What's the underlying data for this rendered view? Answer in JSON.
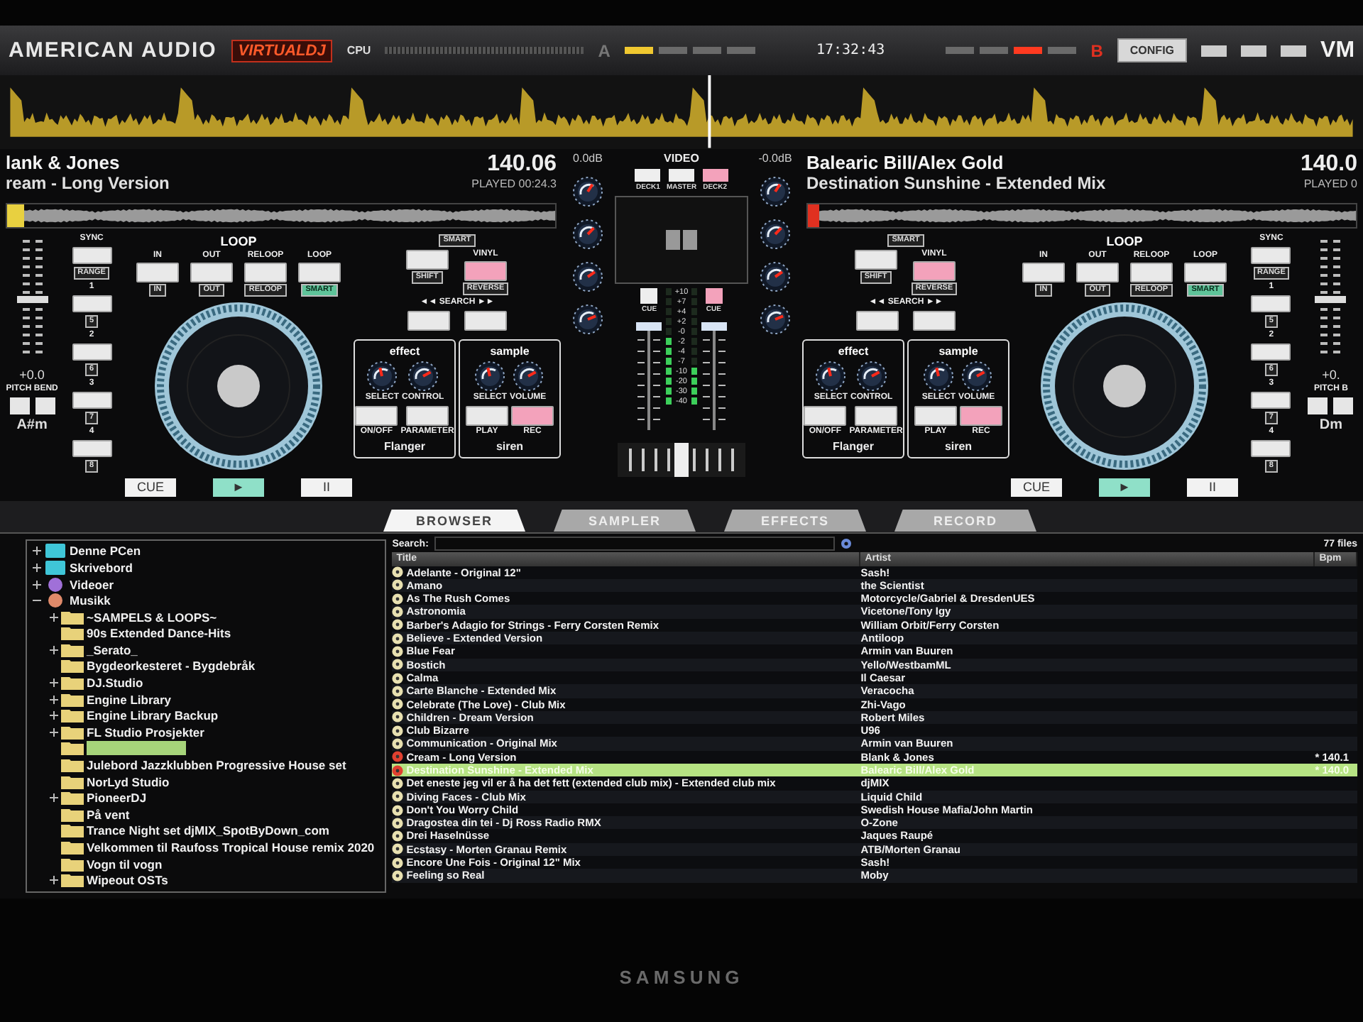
{
  "topbar": {
    "brand": "AMERICAN AUDIO",
    "logo": "VIRTUALDJ",
    "cpu": "CPU",
    "clock": "17:32:43",
    "deck_a": "A",
    "deck_b": "B",
    "config": "CONFIG",
    "logo_right": "VM",
    "a_lights": [
      {
        "on": true
      },
      {
        "on": false
      },
      {
        "on": false
      },
      {
        "on": false
      }
    ],
    "b_lights": [
      {
        "on": false
      },
      {
        "on": false
      },
      {
        "on": true
      },
      {
        "on": false
      }
    ]
  },
  "decks": [
    {
      "artist": "lank & Jones",
      "title": "ream - Long Version",
      "bpm": "140.06",
      "played": "PLAYED 00:24.3",
      "key": "A#m",
      "pitch": "+0.0",
      "pitch_bend": "PITCH BEND",
      "pitch_slider": {
        "level": 0.5
      },
      "sync": {
        "label": "SYNC",
        "sub": "RANGE"
      },
      "hotcues": [
        {
          "label": "1",
          "sub": "5"
        },
        {
          "label": "2",
          "sub": "6"
        },
        {
          "label": "3",
          "sub": "7"
        },
        {
          "label": "4",
          "sub": "8"
        }
      ],
      "loop_title": "LOOP",
      "loop": [
        {
          "label": "IN",
          "sub": "IN",
          "sub_lit": false
        },
        {
          "label": "OUT",
          "sub": "OUT",
          "sub_lit": false
        },
        {
          "label": "RELOOP",
          "sub": "RELOOP",
          "sub_lit": false
        },
        {
          "label": "LOOP",
          "sub": "SMART",
          "sub_lit": true
        }
      ],
      "smart": "SMART",
      "pads": [
        {
          "sub": "SHIFT",
          "on": false
        },
        {
          "label": "VINYL",
          "sub": "REVERSE",
          "on": true
        }
      ],
      "search": "◄◄ SEARCH ►►",
      "search_pads": [
        {
          "on": false
        },
        {
          "on": false
        }
      ],
      "fx": [
        {
          "title": "effect",
          "knobs": [
            "SELECT",
            "CONTROL"
          ],
          "buttons": [
            {
              "label": "ON/OFF",
              "on": false
            },
            {
              "label": "PARAMETER",
              "on": false
            }
          ],
          "name": "Flanger"
        },
        {
          "title": "sample",
          "knobs": [
            "SELECT",
            "VOLUME"
          ],
          "buttons": [
            {
              "label": "PLAY",
              "on": false
            },
            {
              "label": "REC",
              "on": true
            }
          ],
          "name": "siren"
        }
      ],
      "transport": [
        {
          "label": "CUE",
          "kind": "cue"
        },
        {
          "label": "►",
          "kind": "play"
        },
        {
          "label": "II",
          "kind": "pause"
        }
      ]
    },
    {
      "artist": "Balearic Bill/Alex Gold",
      "title": "Destination Sunshine - Extended Mix",
      "bpm": "140.0",
      "played": "PLAYED 0",
      "key": "Dm",
      "pitch": "+0.",
      "pitch_bend": "PITCH B",
      "pitch_slider": {
        "level": 0.5
      },
      "sync": {
        "label": "SYNC",
        "sub": "RANGE"
      },
      "hotcues": [
        {
          "label": "1",
          "sub": "5"
        },
        {
          "label": "2",
          "sub": "6"
        },
        {
          "label": "3",
          "sub": "7"
        },
        {
          "label": "4",
          "sub": "8"
        }
      ],
      "loop_title": "LOOP",
      "loop": [
        {
          "label": "IN",
          "sub": "IN",
          "sub_lit": false
        },
        {
          "label": "OUT",
          "sub": "OUT",
          "sub_lit": false
        },
        {
          "label": "RELOOP",
          "sub": "RELOOP",
          "sub_lit": false
        },
        {
          "label": "LOOP",
          "sub": "SMART",
          "sub_lit": true
        }
      ],
      "smart": "SMART",
      "pads": [
        {
          "sub": "SHIFT",
          "on": false
        },
        {
          "label": "VINYL",
          "sub": "REVERSE",
          "on": true
        }
      ],
      "search": "◄◄ SEARCH ►►",
      "search_pads": [
        {
          "on": false
        },
        {
          "on": false
        }
      ],
      "fx": [
        {
          "title": "effect",
          "knobs": [
            "SELECT",
            "CONTROL"
          ],
          "buttons": [
            {
              "label": "ON/OFF",
              "on": false
            },
            {
              "label": "PARAMETER",
              "on": false
            }
          ],
          "name": "Flanger"
        },
        {
          "title": "sample",
          "knobs": [
            "SELECT",
            "VOLUME"
          ],
          "buttons": [
            {
              "label": "PLAY",
              "on": false
            },
            {
              "label": "REC",
              "on": true
            }
          ],
          "name": "siren"
        }
      ],
      "transport": [
        {
          "label": "CUE",
          "kind": "cue"
        },
        {
          "label": "►",
          "kind": "play"
        },
        {
          "label": "II",
          "kind": "pause"
        }
      ]
    }
  ],
  "mixer": {
    "gains": [
      "0.0dB",
      "-0.0dB"
    ],
    "video_title": "VIDEO",
    "sources": [
      {
        "label": "DECK1",
        "selected": false
      },
      {
        "label": "MASTER",
        "selected": false
      },
      {
        "label": "DECK2",
        "selected": true
      }
    ],
    "cues": [
      {
        "label": "CUE",
        "on": false
      },
      {
        "label": "CUE",
        "on": true
      }
    ],
    "scale": [
      "+10",
      "+7",
      "+4",
      "+2",
      "-0",
      "-2",
      "-4",
      "-7",
      "-10",
      "-20",
      "-30",
      "-40"
    ]
  },
  "tabs": [
    {
      "label": "BROWSER",
      "selected": true
    },
    {
      "label": "SAMPLER",
      "selected": false
    },
    {
      "label": "EFFECTS",
      "selected": false
    },
    {
      "label": "RECORD",
      "selected": false
    }
  ],
  "browser": {
    "tree": [
      {
        "label": "Denne PCen",
        "kind": "computer",
        "expanded": false
      },
      {
        "label": "Skrivebord",
        "kind": "desktop",
        "expanded": false
      },
      {
        "label": "Videoer",
        "kind": "video",
        "expanded": false
      },
      {
        "label": "Musikk",
        "kind": "music",
        "expanded": true,
        "children": [
          {
            "label": "~SAMPELS & LOOPS~",
            "kind": "folder",
            "expanded": false
          },
          {
            "label": "90s Extended Dance-Hits",
            "kind": "folder"
          },
          {
            "label": "_Serato_",
            "kind": "folder",
            "expanded": false
          },
          {
            "label": "Bygdeorkesteret - Bygdebråk",
            "kind": "folder"
          },
          {
            "label": "DJ.Studio",
            "kind": "folder",
            "expanded": false
          },
          {
            "label": "Engine Library",
            "kind": "folder",
            "expanded": false
          },
          {
            "label": "Engine Library Backup",
            "kind": "folder",
            "expanded": false
          },
          {
            "label": "FL Studio Prosjekter",
            "kind": "folder",
            "expanded": false
          },
          {
            "kind": "folder",
            "selected": true
          },
          {
            "label": "Julebord Jazzklubben Progressive House set",
            "kind": "folder"
          },
          {
            "label": "NorLyd Studio",
            "kind": "folder"
          },
          {
            "label": "PioneerDJ",
            "kind": "folder",
            "expanded": false
          },
          {
            "label": "På vent",
            "kind": "folder"
          },
          {
            "label": "Trance Night set djMIX_SpotByDown_com",
            "kind": "folder"
          },
          {
            "label": "Velkommen til Raufoss Tropical House remix 2020",
            "kind": "folder"
          },
          {
            "label": "Vogn til vogn",
            "kind": "folder"
          },
          {
            "label": "Wipeout OSTs",
            "kind": "folder",
            "expanded": false
          }
        ]
      }
    ],
    "search_label": "Search:",
    "file_count": "77 files",
    "columns": [
      "Title",
      "Artist",
      "Bpm"
    ],
    "rows": [
      {
        "title": "Adelante - Original 12\"",
        "artist": "Sash!",
        "loaded": false,
        "selected": false
      },
      {
        "title": "Amano",
        "artist": "the Scientist",
        "loaded": false,
        "selected": false
      },
      {
        "title": "As The Rush Comes",
        "artist": "Motorcycle/Gabriel & DresdenUES",
        "loaded": false,
        "selected": false
      },
      {
        "title": "Astronomia",
        "artist": "Vicetone/Tony Igy",
        "loaded": false,
        "selected": false
      },
      {
        "title": "Barber's Adagio for Strings - Ferry Corsten Remix",
        "artist": "William Orbit/Ferry Corsten",
        "loaded": false,
        "selected": false
      },
      {
        "title": "Believe - Extended Version",
        "artist": "Antiloop",
        "loaded": false,
        "selected": false
      },
      {
        "title": "Blue Fear",
        "artist": "Armin van Buuren",
        "loaded": false,
        "selected": false
      },
      {
        "title": "Bostich",
        "artist": "Yello/WestbamML",
        "loaded": false,
        "selected": false
      },
      {
        "title": "Calma",
        "artist": "Il Caesar",
        "loaded": false,
        "selected": false
      },
      {
        "title": "Carte Blanche - Extended Mix",
        "artist": "Veracocha",
        "loaded": false,
        "selected": false
      },
      {
        "title": "Celebrate (The Love) - Club Mix",
        "artist": "Zhi-Vago",
        "loaded": false,
        "selected": false
      },
      {
        "title": "Children - Dream Version",
        "artist": "Robert Miles",
        "loaded": false,
        "selected": false
      },
      {
        "title": "Club Bizarre",
        "artist": "U96",
        "loaded": false,
        "selected": false
      },
      {
        "title": "Communication - Original Mix",
        "artist": "Armin van Buuren",
        "loaded": false,
        "selected": false
      },
      {
        "title": "Cream - Long Version",
        "artist": "Blank & Jones",
        "bpm": "* 140.1",
        "loaded": true,
        "selected": false
      },
      {
        "title": "Destination Sunshine - Extended Mix",
        "artist": "Balearic Bill/Alex Gold",
        "bpm": "* 140.0",
        "loaded": true,
        "selected": true
      },
      {
        "title": "Det eneste jeg vil er å ha det fett (extended club mix) - Extended club mix",
        "artist": "djMIX",
        "loaded": false,
        "selected": false
      },
      {
        "title": "Diving Faces - Club Mix",
        "artist": "Liquid Child",
        "loaded": false,
        "selected": false
      },
      {
        "title": "Don't You Worry Child",
        "artist": "Swedish House Mafia/John Martin",
        "loaded": false,
        "selected": false
      },
      {
        "title": "Dragostea din tei - Dj Ross Radio RMX",
        "artist": "O-Zone",
        "loaded": false,
        "selected": false
      },
      {
        "title": "Drei Haselnüsse",
        "artist": "Jaques Raupé",
        "loaded": false,
        "selected": false
      },
      {
        "title": "Ecstasy - Morten Granau Remix",
        "artist": "ATB/Morten Granau",
        "loaded": false,
        "selected": false
      },
      {
        "title": "Encore Une Fois - Original 12\" Mix",
        "artist": "Sash!",
        "loaded": false,
        "selected": false
      },
      {
        "title": "Feeling so Real",
        "artist": "Moby",
        "loaded": false,
        "selected": false
      }
    ]
  },
  "monitor": {
    "brand": "SAMSUNG"
  }
}
